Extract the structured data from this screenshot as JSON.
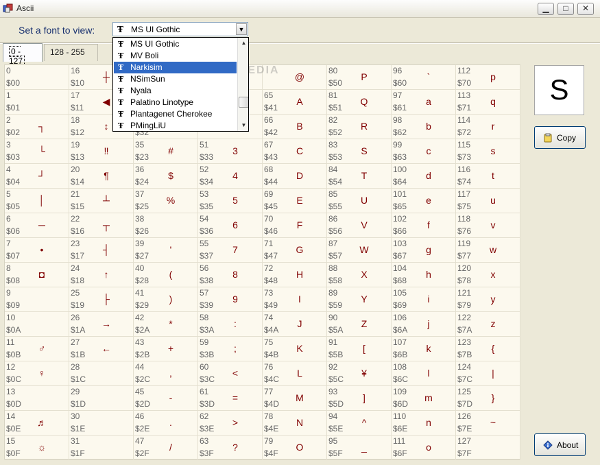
{
  "window": {
    "title": "Ascii"
  },
  "toolbar": {
    "font_label": "Set a font to view:",
    "font_selected": "MS UI Gothic",
    "font_options": [
      "MS UI Gothic",
      "MV Boli",
      "Narkisim",
      "NSimSun",
      "Nyala",
      "Palatino Linotype",
      "Plantagenet Cherokee",
      "PMingLiU"
    ],
    "highlighted_option_index": 2
  },
  "tabs": [
    {
      "label": "0 - 127",
      "active": true
    },
    {
      "label": "128 - 255",
      "active": false
    }
  ],
  "preview": {
    "char": "S"
  },
  "buttons": {
    "copy": "Copy",
    "about": "About"
  },
  "watermark": "SOFTPEDIA",
  "icons": [
    "app-icon",
    "minimize-icon",
    "maximize-icon",
    "close-icon",
    "chevron-down-icon",
    "truetype-font-icon",
    "clipboard-icon",
    "info-icon"
  ],
  "colors": {
    "char_color": "#800000",
    "grid_bg": "#fcf9ee",
    "highlight": "#316ac5",
    "label_color": "#1a3270"
  },
  "grid": {
    "columns": [
      {
        "cells": [
          {
            "dec": "0",
            "hex": "$00",
            "ch": ""
          },
          {
            "dec": "1",
            "hex": "$01",
            "ch": ""
          },
          {
            "dec": "2",
            "hex": "$02",
            "ch": "┐"
          },
          {
            "dec": "3",
            "hex": "$03",
            "ch": "└"
          },
          {
            "dec": "4",
            "hex": "$04",
            "ch": "┘"
          },
          {
            "dec": "5",
            "hex": "$05",
            "ch": "│"
          },
          {
            "dec": "6",
            "hex": "$06",
            "ch": "─"
          },
          {
            "dec": "7",
            "hex": "$07",
            "ch": "•"
          },
          {
            "dec": "8",
            "hex": "$08",
            "ch": "◘"
          },
          {
            "dec": "9",
            "hex": "$09",
            "ch": ""
          },
          {
            "dec": "10",
            "hex": "$0A",
            "ch": ""
          },
          {
            "dec": "11",
            "hex": "$0B",
            "ch": "♂"
          },
          {
            "dec": "12",
            "hex": "$0C",
            "ch": "♀"
          },
          {
            "dec": "13",
            "hex": "$0D",
            "ch": ""
          },
          {
            "dec": "14",
            "hex": "$0E",
            "ch": "♬"
          },
          {
            "dec": "15",
            "hex": "$0F",
            "ch": "☼"
          }
        ]
      },
      {
        "cells": [
          {
            "dec": "16",
            "hex": "$10",
            "ch": "┼"
          },
          {
            "dec": "17",
            "hex": "$11",
            "ch": "◀"
          },
          {
            "dec": "18",
            "hex": "$12",
            "ch": "↕"
          },
          {
            "dec": "19",
            "hex": "$13",
            "ch": "‼"
          },
          {
            "dec": "20",
            "hex": "$14",
            "ch": "¶"
          },
          {
            "dec": "21",
            "hex": "$15",
            "ch": "┴"
          },
          {
            "dec": "22",
            "hex": "$16",
            "ch": "┬"
          },
          {
            "dec": "23",
            "hex": "$17",
            "ch": "┤"
          },
          {
            "dec": "24",
            "hex": "$18",
            "ch": "↑"
          },
          {
            "dec": "25",
            "hex": "$19",
            "ch": "├"
          },
          {
            "dec": "26",
            "hex": "$1A",
            "ch": "→"
          },
          {
            "dec": "27",
            "hex": "$1B",
            "ch": "←"
          },
          {
            "dec": "28",
            "hex": "$1C",
            "ch": ""
          },
          {
            "dec": "29",
            "hex": "$1D",
            "ch": ""
          },
          {
            "dec": "30",
            "hex": "$1E",
            "ch": ""
          },
          {
            "dec": "31",
            "hex": "$1F",
            "ch": ""
          }
        ]
      },
      {
        "cells": [
          {
            "dec": "",
            "hex": "",
            "ch": ""
          },
          {
            "dec": "",
            "hex": "",
            "ch": ""
          },
          {
            "dec": "",
            "hex": "$32",
            "ch": ""
          },
          {
            "dec": "35",
            "hex": "$23",
            "ch": "#"
          },
          {
            "dec": "36",
            "hex": "$24",
            "ch": "$"
          },
          {
            "dec": "37",
            "hex": "$25",
            "ch": "%"
          },
          {
            "dec": "38",
            "hex": "$26",
            "ch": ""
          },
          {
            "dec": "39",
            "hex": "$27",
            "ch": "'"
          },
          {
            "dec": "40",
            "hex": "$28",
            "ch": "("
          },
          {
            "dec": "41",
            "hex": "$29",
            "ch": ")"
          },
          {
            "dec": "42",
            "hex": "$2A",
            "ch": "*"
          },
          {
            "dec": "43",
            "hex": "$2B",
            "ch": "+"
          },
          {
            "dec": "44",
            "hex": "$2C",
            "ch": ","
          },
          {
            "dec": "45",
            "hex": "$2D",
            "ch": "-"
          },
          {
            "dec": "46",
            "hex": "$2E",
            "ch": "."
          },
          {
            "dec": "47",
            "hex": "$2F",
            "ch": "/"
          }
        ]
      },
      {
        "cells": [
          {
            "dec": "",
            "hex": "",
            "ch": ""
          },
          {
            "dec": "",
            "hex": "",
            "ch": ""
          },
          {
            "dec": "",
            "hex": "",
            "ch": ""
          },
          {
            "dec": "51",
            "hex": "$33",
            "ch": "3"
          },
          {
            "dec": "52",
            "hex": "$34",
            "ch": "4"
          },
          {
            "dec": "53",
            "hex": "$35",
            "ch": "5"
          },
          {
            "dec": "54",
            "hex": "$36",
            "ch": "6"
          },
          {
            "dec": "55",
            "hex": "$37",
            "ch": "7"
          },
          {
            "dec": "56",
            "hex": "$38",
            "ch": "8"
          },
          {
            "dec": "57",
            "hex": "$39",
            "ch": "9"
          },
          {
            "dec": "58",
            "hex": "$3A",
            "ch": ":"
          },
          {
            "dec": "59",
            "hex": "$3B",
            "ch": ";"
          },
          {
            "dec": "60",
            "hex": "$3C",
            "ch": "<"
          },
          {
            "dec": "61",
            "hex": "$3D",
            "ch": "="
          },
          {
            "dec": "62",
            "hex": "$3E",
            "ch": ">"
          },
          {
            "dec": "63",
            "hex": "$3F",
            "ch": "?"
          }
        ]
      },
      {
        "cells": [
          {
            "dec": "",
            "hex": "",
            "ch": "@"
          },
          {
            "dec": "65",
            "hex": "$41",
            "ch": "A"
          },
          {
            "dec": "66",
            "hex": "$42",
            "ch": "B"
          },
          {
            "dec": "67",
            "hex": "$43",
            "ch": "C"
          },
          {
            "dec": "68",
            "hex": "$44",
            "ch": "D"
          },
          {
            "dec": "69",
            "hex": "$45",
            "ch": "E"
          },
          {
            "dec": "70",
            "hex": "$46",
            "ch": "F"
          },
          {
            "dec": "71",
            "hex": "$47",
            "ch": "G"
          },
          {
            "dec": "72",
            "hex": "$48",
            "ch": "H"
          },
          {
            "dec": "73",
            "hex": "$49",
            "ch": "I"
          },
          {
            "dec": "74",
            "hex": "$4A",
            "ch": "J"
          },
          {
            "dec": "75",
            "hex": "$4B",
            "ch": "K"
          },
          {
            "dec": "76",
            "hex": "$4C",
            "ch": "L"
          },
          {
            "dec": "77",
            "hex": "$4D",
            "ch": "M"
          },
          {
            "dec": "78",
            "hex": "$4E",
            "ch": "N"
          },
          {
            "dec": "79",
            "hex": "$4F",
            "ch": "O"
          }
        ]
      },
      {
        "cells": [
          {
            "dec": "80",
            "hex": "$50",
            "ch": "P"
          },
          {
            "dec": "81",
            "hex": "$51",
            "ch": "Q"
          },
          {
            "dec": "82",
            "hex": "$52",
            "ch": "R"
          },
          {
            "dec": "83",
            "hex": "$53",
            "ch": "S"
          },
          {
            "dec": "84",
            "hex": "$54",
            "ch": "T"
          },
          {
            "dec": "85",
            "hex": "$55",
            "ch": "U"
          },
          {
            "dec": "86",
            "hex": "$56",
            "ch": "V"
          },
          {
            "dec": "87",
            "hex": "$57",
            "ch": "W"
          },
          {
            "dec": "88",
            "hex": "$58",
            "ch": "X"
          },
          {
            "dec": "89",
            "hex": "$59",
            "ch": "Y"
          },
          {
            "dec": "90",
            "hex": "$5A",
            "ch": "Z"
          },
          {
            "dec": "91",
            "hex": "$5B",
            "ch": "["
          },
          {
            "dec": "92",
            "hex": "$5C",
            "ch": "¥"
          },
          {
            "dec": "93",
            "hex": "$5D",
            "ch": "]"
          },
          {
            "dec": "94",
            "hex": "$5E",
            "ch": "^"
          },
          {
            "dec": "95",
            "hex": "$5F",
            "ch": "_"
          }
        ]
      },
      {
        "cells": [
          {
            "dec": "96",
            "hex": "$60",
            "ch": "`"
          },
          {
            "dec": "97",
            "hex": "$61",
            "ch": "a"
          },
          {
            "dec": "98",
            "hex": "$62",
            "ch": "b"
          },
          {
            "dec": "99",
            "hex": "$63",
            "ch": "c"
          },
          {
            "dec": "100",
            "hex": "$64",
            "ch": "d"
          },
          {
            "dec": "101",
            "hex": "$65",
            "ch": "e"
          },
          {
            "dec": "102",
            "hex": "$66",
            "ch": "f"
          },
          {
            "dec": "103",
            "hex": "$67",
            "ch": "g"
          },
          {
            "dec": "104",
            "hex": "$68",
            "ch": "h"
          },
          {
            "dec": "105",
            "hex": "$69",
            "ch": "i"
          },
          {
            "dec": "106",
            "hex": "$6A",
            "ch": "j"
          },
          {
            "dec": "107",
            "hex": "$6B",
            "ch": "k"
          },
          {
            "dec": "108",
            "hex": "$6C",
            "ch": "l"
          },
          {
            "dec": "109",
            "hex": "$6D",
            "ch": "m"
          },
          {
            "dec": "110",
            "hex": "$6E",
            "ch": "n"
          },
          {
            "dec": "111",
            "hex": "$6F",
            "ch": "o"
          }
        ]
      },
      {
        "cells": [
          {
            "dec": "112",
            "hex": "$70",
            "ch": "p"
          },
          {
            "dec": "113",
            "hex": "$71",
            "ch": "q"
          },
          {
            "dec": "114",
            "hex": "$72",
            "ch": "r"
          },
          {
            "dec": "115",
            "hex": "$73",
            "ch": "s"
          },
          {
            "dec": "116",
            "hex": "$74",
            "ch": "t"
          },
          {
            "dec": "117",
            "hex": "$75",
            "ch": "u"
          },
          {
            "dec": "118",
            "hex": "$76",
            "ch": "v"
          },
          {
            "dec": "119",
            "hex": "$77",
            "ch": "w"
          },
          {
            "dec": "120",
            "hex": "$78",
            "ch": "x"
          },
          {
            "dec": "121",
            "hex": "$79",
            "ch": "y"
          },
          {
            "dec": "122",
            "hex": "$7A",
            "ch": "z"
          },
          {
            "dec": "123",
            "hex": "$7B",
            "ch": "{"
          },
          {
            "dec": "124",
            "hex": "$7C",
            "ch": "|"
          },
          {
            "dec": "125",
            "hex": "$7D",
            "ch": "}"
          },
          {
            "dec": "126",
            "hex": "$7E",
            "ch": "~"
          },
          {
            "dec": "127",
            "hex": "$7F",
            "ch": ""
          }
        ]
      }
    ]
  }
}
